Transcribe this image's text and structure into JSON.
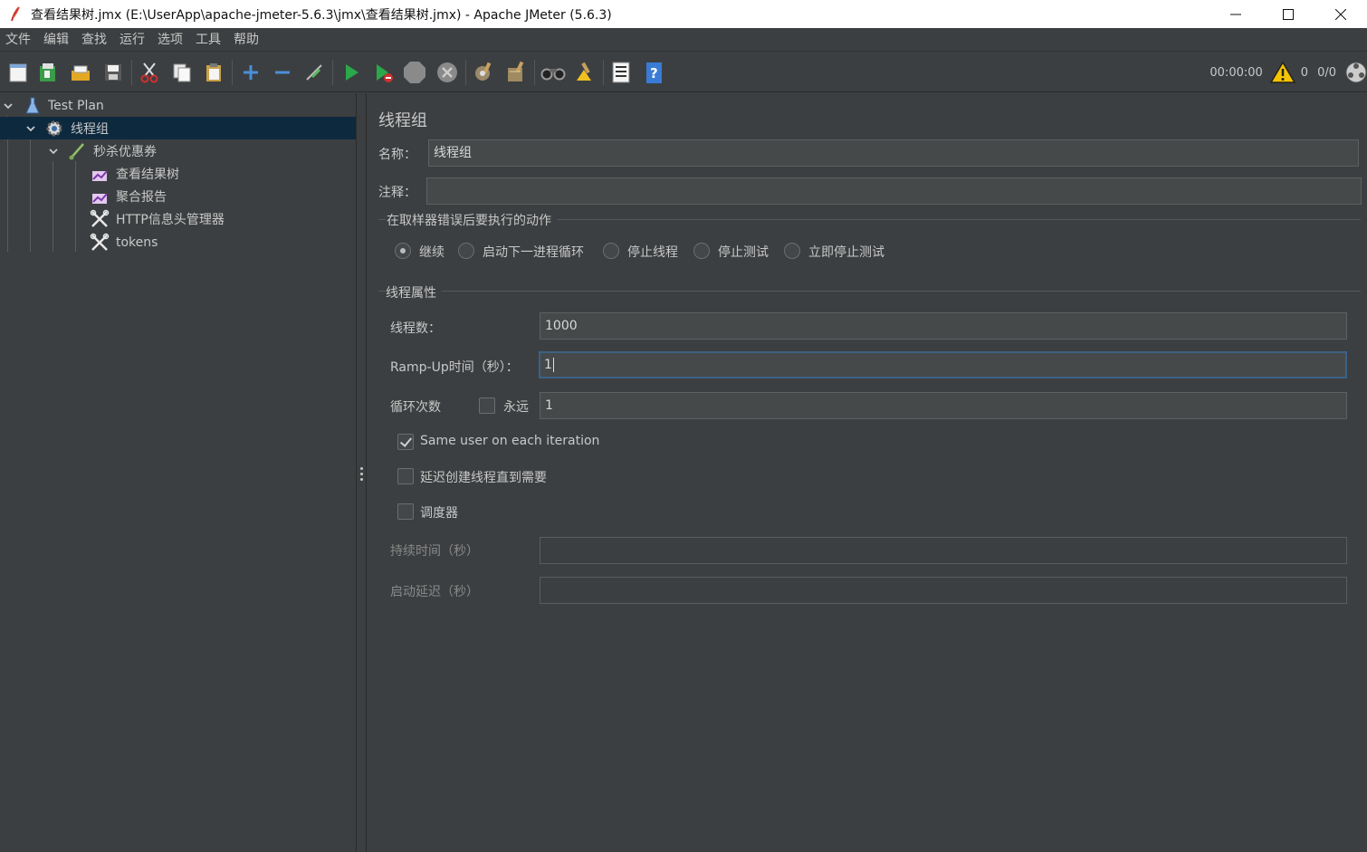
{
  "window": {
    "title": "查看结果树.jmx (E:\\UserApp\\apache-jmeter-5.6.3\\jmx\\查看结果树.jmx) - Apache JMeter (5.6.3)"
  },
  "menu": [
    "文件",
    "编辑",
    "查找",
    "运行",
    "选项",
    "工具",
    "帮助"
  ],
  "toolbar": {
    "buttons": [
      "new-icon",
      "templates-icon",
      "open-icon",
      "save-icon",
      "cut-icon",
      "copy-icon",
      "paste-icon",
      "expand-icon",
      "collapse-icon",
      "toggle-icon",
      "start-icon",
      "start-no-pause-icon",
      "stop-icon",
      "shutdown-icon",
      "clear-icon",
      "clear-all-icon",
      "search-icon",
      "reset-search-icon",
      "function-helper-icon",
      "help-icon"
    ],
    "timer": "00:00:00",
    "warning_count": "0",
    "thread_count": "0/0"
  },
  "tree": {
    "items": [
      {
        "label": "Test Plan",
        "icon": "test-plan-icon"
      },
      {
        "label": "线程组",
        "icon": "gear-icon"
      },
      {
        "label": "秒杀优惠券",
        "icon": "sampler-icon"
      },
      {
        "label": "查看结果树",
        "icon": "listener-icon"
      },
      {
        "label": "聚合报告",
        "icon": "listener-icon"
      },
      {
        "label": "HTTP信息头管理器",
        "icon": "config-icon"
      },
      {
        "label": "tokens",
        "icon": "config-icon"
      }
    ]
  },
  "panel": {
    "title": "线程组",
    "name_label": "名称：",
    "name_value": "线程组",
    "comment_label": "注释：",
    "comment_value": "",
    "error_group_title": "在取样器错误后要执行的动作",
    "error_actions": [
      "继续",
      "启动下一进程循环",
      "停止线程",
      "停止测试",
      "立即停止测试"
    ],
    "error_action_selected": "继续",
    "thread_group_title": "线程属性",
    "threads_label": "线程数：",
    "threads_value": "1000",
    "rampup_label": "Ramp-Up时间（秒）：",
    "rampup_value": "1",
    "loops_label": "循环次数",
    "forever_label": "永远",
    "forever_checked": false,
    "loops_value": "1",
    "same_user_label": "Same user on each iteration",
    "same_user_checked": true,
    "delay_create_label": "延迟创建线程直到需要",
    "delay_create_checked": false,
    "scheduler_label": "调度器",
    "scheduler_checked": false,
    "duration_label": "持续时间（秒）",
    "duration_value": "",
    "startup_delay_label": "启动延迟（秒）",
    "startup_delay_value": ""
  },
  "colors": {
    "background": "#3c3f41",
    "selection": "#0d293e",
    "focus_border": "#3d6185"
  }
}
